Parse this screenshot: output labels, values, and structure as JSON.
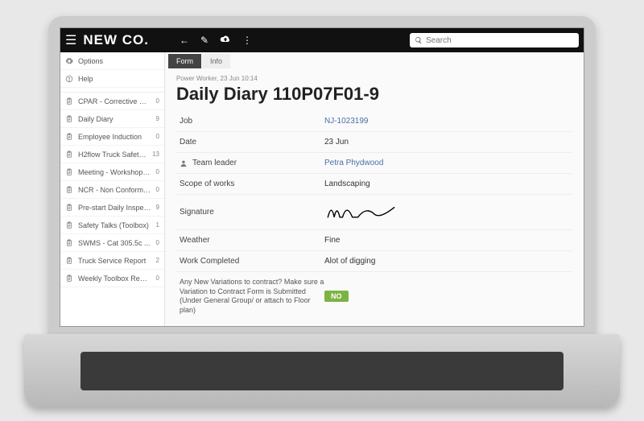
{
  "header": {
    "brand_text": "NEW CO.",
    "search_placeholder": "Search"
  },
  "sidebar": {
    "top": [
      {
        "icon": "gear",
        "label": "Options"
      },
      {
        "icon": "help",
        "label": "Help"
      }
    ],
    "items": [
      {
        "label": "CPAR - Corrective Pr...",
        "count": "0"
      },
      {
        "label": "Daily Diary",
        "count": "9"
      },
      {
        "label": "Employee Induction",
        "count": "0"
      },
      {
        "label": "H2flow Truck Safety...",
        "count": "13"
      },
      {
        "label": "Meeting - Workshop T...",
        "count": "0"
      },
      {
        "label": "NCR - Non Conforma...",
        "count": "0"
      },
      {
        "label": "Pre-start Daily Inspec...",
        "count": "9"
      },
      {
        "label": "Safety Talks (Toolbox)",
        "count": "1"
      },
      {
        "label": "SWMS - Cat 305.5c ...",
        "count": "0"
      },
      {
        "label": "Truck Service Report",
        "count": "2"
      },
      {
        "label": "Weekly Toolbox Report",
        "count": "0"
      }
    ]
  },
  "tabs": [
    {
      "label": "Form",
      "active": true
    },
    {
      "label": "Info",
      "active": false
    }
  ],
  "doc": {
    "crumb": "Power Worker, 23 Jun 10:14",
    "title": "Daily Diary 110P07F01-9",
    "rows": [
      {
        "k": "Job",
        "v": "NJ-1023199",
        "link": true
      },
      {
        "k": "Date",
        "v": "23 Jun"
      },
      {
        "k": "Team leader",
        "v": "Petra Phydwood",
        "link": true,
        "person": true
      },
      {
        "k": "Scope of works",
        "v": "Landscaping"
      },
      {
        "k": "Signature",
        "v": "",
        "sig": true
      },
      {
        "k": "Weather",
        "v": "Fine"
      },
      {
        "k": "Work Completed",
        "v": "Alot of digging"
      }
    ],
    "question": "Any New Variations to contract? Make sure a Variation to Contract Form is Submitted (Under General Group/ or attach to Floor plan)",
    "answer": "NO"
  }
}
